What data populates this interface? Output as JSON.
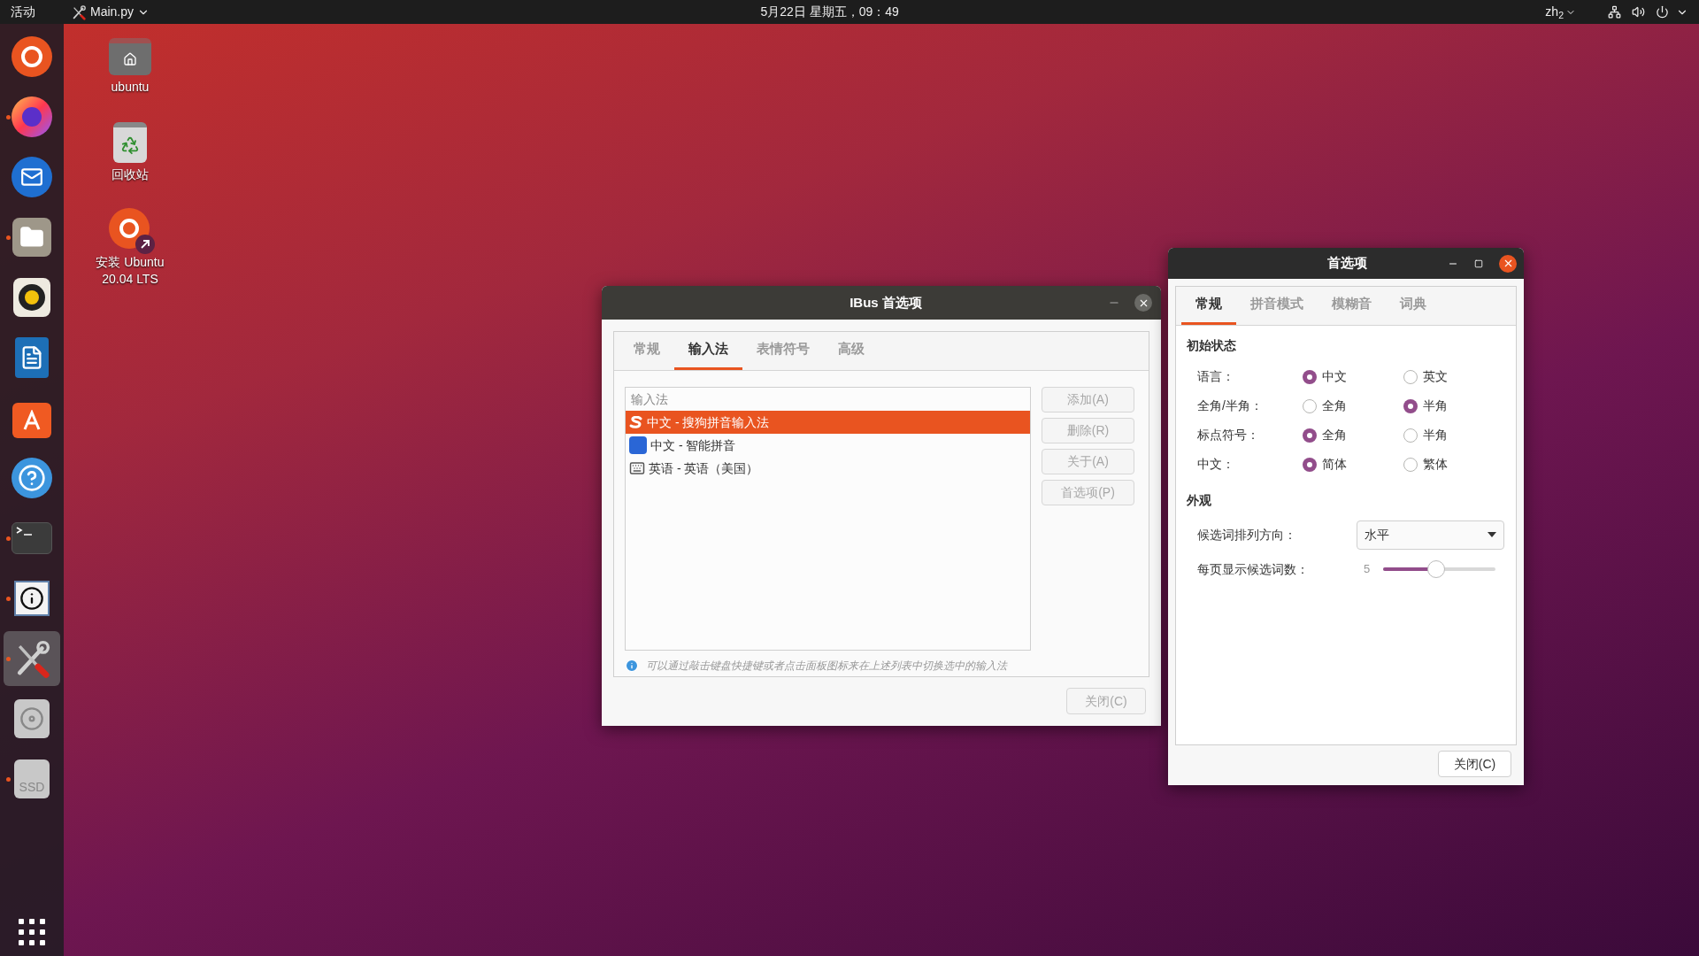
{
  "top_bar": {
    "activities": "活动",
    "app_menu": "Main.py",
    "clock": "5月22日 星期五，09：49",
    "input_source": "zh$_{2}$"
  },
  "dock": [
    {
      "kind": "ubuntu",
      "running": false,
      "selected": false
    },
    {
      "kind": "firefox",
      "running": true,
      "selected": false
    },
    {
      "kind": "mail",
      "running": false,
      "selected": false
    },
    {
      "kind": "files",
      "running": true,
      "selected": false
    },
    {
      "kind": "speaker",
      "running": false,
      "selected": false
    },
    {
      "kind": "document",
      "running": false,
      "selected": false
    },
    {
      "kind": "store",
      "running": false,
      "selected": false
    },
    {
      "kind": "help",
      "running": false,
      "selected": false
    },
    {
      "kind": "terminal",
      "running": true,
      "selected": false
    },
    {
      "kind": "info",
      "running": true,
      "selected": false
    },
    {
      "kind": "tools",
      "running": true,
      "selected": true
    },
    {
      "kind": "disc",
      "running": false,
      "selected": false
    },
    {
      "kind": "drive",
      "running": true,
      "selected": false,
      "label": "SSD"
    }
  ],
  "desktop_icons": [
    {
      "kind": "home",
      "lines": [
        "ubuntu"
      ]
    },
    {
      "kind": "trash",
      "lines": [
        "回收站"
      ]
    },
    {
      "kind": "installer",
      "lines": [
        "安装 Ubuntu",
        "20.04 LTS"
      ]
    }
  ],
  "ibus_window": {
    "title": "IBus 首选项",
    "tabs": [
      {
        "label": "常规",
        "selected": false
      },
      {
        "label": "输入法",
        "selected": true
      },
      {
        "label": "表情符号",
        "selected": false
      },
      {
        "label": "高级",
        "selected": false
      }
    ],
    "list_header": "输入法",
    "methods": [
      {
        "kind": "sogou",
        "label": "中文 - 搜狗拼音输入法",
        "selected": true
      },
      {
        "kind": "pinyin",
        "label": "中文 - 智能拼音",
        "selected": false
      },
      {
        "kind": "keyboard",
        "label": "英语 - 英语（美国）",
        "selected": false
      }
    ],
    "side_buttons": [
      {
        "label": "添加(A)",
        "disabled": true
      },
      {
        "label": "删除(R)",
        "disabled": true
      },
      {
        "label": "关于(A)",
        "disabled": true
      },
      {
        "label": "首选项(P)",
        "disabled": true
      }
    ],
    "hint": "可以通过敲击键盘快捷键或者点击面板图标来在上述列表中切换选中的输入法",
    "close_button": {
      "label": "关闭(C)",
      "disabled": true
    }
  },
  "prefs_window": {
    "title": "首选项",
    "tabs": [
      {
        "label": "常规",
        "selected": true
      },
      {
        "label": "拼音模式",
        "selected": false
      },
      {
        "label": "模糊音",
        "selected": false
      },
      {
        "label": "词典",
        "selected": false
      }
    ],
    "initial_state": {
      "heading": "初始状态",
      "rows": [
        {
          "label": "语言：",
          "options": [
            {
              "label": "中文",
              "selected": true
            },
            {
              "label": "英文",
              "selected": false
            }
          ]
        },
        {
          "label": "全角/半角：",
          "options": [
            {
              "label": "全角",
              "selected": false
            },
            {
              "label": "半角",
              "selected": true
            }
          ]
        },
        {
          "label": "标点符号：",
          "options": [
            {
              "label": "全角",
              "selected": true
            },
            {
              "label": "半角",
              "selected": false
            }
          ]
        },
        {
          "label": "中文：",
          "options": [
            {
              "label": "简体",
              "selected": true
            },
            {
              "label": "繁体",
              "selected": false
            }
          ]
        }
      ]
    },
    "appearance": {
      "heading": "外观",
      "orientation_label": "候选词排列方向：",
      "orientation_value": "水平",
      "page_size_label": "每页显示候选词数：",
      "page_size_slider": {
        "reading": "5",
        "level": 0.47
      }
    },
    "close_button": "关闭(C)"
  }
}
